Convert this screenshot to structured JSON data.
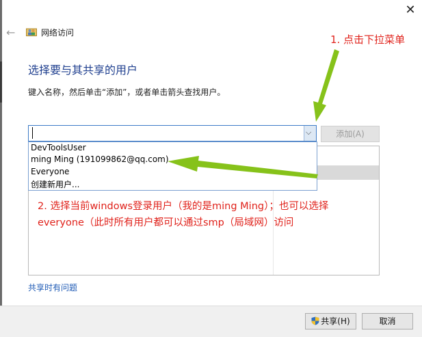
{
  "window": {
    "close_glyph": "✕"
  },
  "nav": {
    "back_glyph": "←",
    "title": "网络访问"
  },
  "heading": "选择要与其共享的用户",
  "instruction": "键入名称，然后单击“添加”，或者单击箭头查找用户。",
  "combo": {
    "value": "",
    "dropdown_glyph": "⌵"
  },
  "add_button": "添加(A)",
  "dropdown_items": [
    "DevToolsUser",
    "ming Ming (191099862@qq.com)",
    "Everyone",
    "创建新用户..."
  ],
  "annotations": {
    "step1": "1. 点击下拉菜单",
    "step2": "2. 选择当前windows登录用户（我的是ming Ming）；也可以选择everyone（此时所有用户都可以通过smp（局域网）访问"
  },
  "help_link": "共享时有问题",
  "buttons": {
    "share": "共享(H)",
    "cancel": "取消"
  },
  "colors": {
    "annotation": "#e0221b",
    "arrow_green": "#86c21a",
    "heading": "#1f3f8f",
    "link": "#1f5bb5"
  },
  "icons": [
    "close-icon",
    "back-arrow-icon",
    "network-users-icon",
    "dropdown-chevron-icon",
    "uac-shield-icon"
  ]
}
